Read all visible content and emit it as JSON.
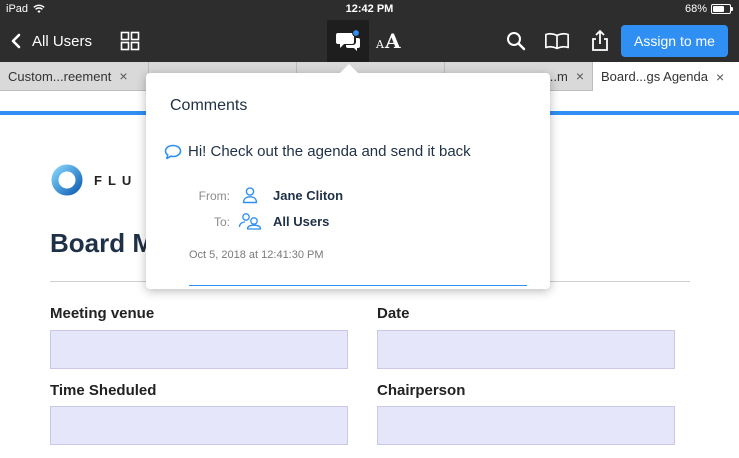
{
  "status_bar": {
    "device": "iPad",
    "time": "12:42 PM",
    "battery": "68%",
    "battery_level": 0.68
  },
  "toolbar": {
    "back_label": "All Users",
    "font_small": "A",
    "font_big": "A",
    "assign_label": "Assign to me"
  },
  "tabs": [
    {
      "label": "Custom...reement",
      "active": false
    },
    {
      "label": "",
      "active": false
    },
    {
      "label": "",
      "active": false
    },
    {
      "label": "...m",
      "active": false
    },
    {
      "label": "Board...gs Agenda",
      "active": true
    }
  ],
  "tab_close": "×",
  "document": {
    "logo_text": "FLU",
    "title": "Board M",
    "fields": [
      {
        "label": "Meeting venue"
      },
      {
        "label": "Date"
      },
      {
        "label": "Time Sheduled"
      },
      {
        "label": "Chairperson"
      }
    ]
  },
  "comments_popover": {
    "title": "Comments",
    "comment_text": "Hi! Check out the agenda and send it back",
    "from_label": "From:",
    "from_value": "Jane Cliton",
    "to_label": "To:",
    "to_value": "All Users",
    "timestamp": "Oct 5, 2018 at 12:41:30 PM"
  },
  "colors": {
    "accent": "#2f8ff3",
    "toolbar_bg": "#2d2d2d",
    "field_bg": "#e6e6fa",
    "text_dark": "#1f3147"
  }
}
